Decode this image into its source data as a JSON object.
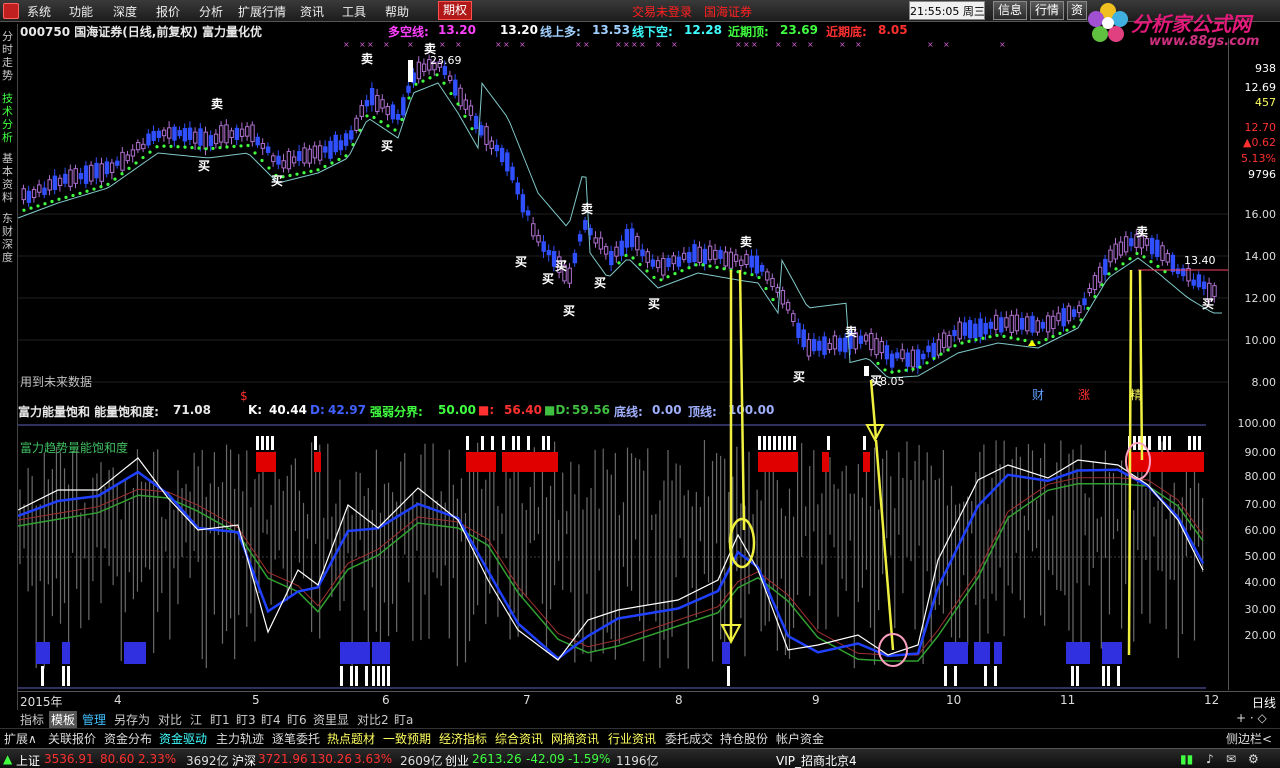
{
  "menu": {
    "items": [
      "系统",
      "功能",
      "深度",
      "报价",
      "分析",
      "扩展行情",
      "资讯",
      "工具",
      "帮助"
    ],
    "options_tab": "期权",
    "trade_status": "交易未登录",
    "broker": "国海证券",
    "time": "21:55:05",
    "weekday": "周三",
    "buttons": [
      "信息",
      "行情",
      "资"
    ]
  },
  "watermark": {
    "title": "分析家公式网",
    "url": "www.88gs.com"
  },
  "side_tabs": [
    "分时走势",
    "技术分析",
    "基本资料",
    "东财深度"
  ],
  "header": {
    "stock": "000750 国海证券(日线,前复权) 富力量化优",
    "duokong_label": "多空线:",
    "duokong_value": "13.20",
    "v2": "13.20",
    "xianshangduo_label": "线上多:",
    "xianshangduo_value": "13.53",
    "xianxiakong_label": "线下空:",
    "xianxiakong_value": "12.28",
    "jinqiding_label": "近期顶:",
    "jinqiding_value": "23.69",
    "jinqidi_label": "近期底:",
    "jinqidi_value": "8.05"
  },
  "chart_labels": {
    "future_data": "用到未来数据",
    "high_price": "23.69",
    "low_price": "8.05",
    "last_price": "13.40",
    "dollar_mark": "$",
    "cai": "财",
    "zhang": "涨",
    "zhang2": "精",
    "buy": "买",
    "sell": "卖"
  },
  "indicator_header": {
    "title": "富力能量饱和 能量饱和度:",
    "value": "71.08",
    "k_label": "K:",
    "k_value": "40.44",
    "d_label": "D:",
    "d_value": "42.97",
    "qiangruo_label": "强弱分界:",
    "qiangruo_value": "50.00",
    "m1_label": "■:",
    "m1_value": "56.40",
    "m2_label": "■D:",
    "m2_value": "59.56",
    "dixian_label": "底线:",
    "dixian_value": "0.00",
    "dingxian_label": "顶线:",
    "dingxian_value": "100.00"
  },
  "indicator_title2": "富力趋势量能饱和度",
  "right_axis": {
    "main": [
      "938",
      "12.69",
      "457",
      "12.70",
      "▲0.62",
      "5.13%",
      "9796",
      "16.00",
      "14.00",
      "12.00",
      "10.00",
      "8.00"
    ],
    "indicator": [
      "100.00",
      "90.00",
      "80.00",
      "70.00",
      "60.00",
      "50.00",
      "40.00",
      "30.00",
      "20.00"
    ],
    "date_right": "日线",
    "controls": "+ · ◇"
  },
  "date_axis": [
    "2015年",
    "4",
    "5",
    "6",
    "7",
    "8",
    "9",
    "10",
    "11",
    "12"
  ],
  "tabs1": [
    "指标",
    "模板",
    "管理",
    "另存为",
    "对比",
    "江",
    "盯1",
    "盯3",
    "盯4",
    "盯6",
    "资里显",
    "对比2",
    "盯a"
  ],
  "tabs2": [
    "扩展∧",
    "关联报价",
    "资金分布",
    "资金驱动",
    "主力轨迹",
    "逐笔委托",
    "热点题材",
    "一致预期",
    "经济指标",
    "综合资讯",
    "网摘资讯",
    "行业资讯",
    "委托成交",
    "持仓股份",
    "帐户资金"
  ],
  "tabs2_right": "侧边栏<",
  "status": {
    "sh_label": "上证",
    "sh_value": "3536.91",
    "sh_change": "80.60",
    "sh_pct": "2.33%",
    "sh_amount": "3692亿",
    "hs_label": "沪深",
    "hs_value": "3721.96",
    "hs_change": "130.26",
    "hs_pct": "3.63%",
    "hs_amount": "2609亿",
    "cy_label": "创业",
    "cy_value": "2613.26",
    "cy_change": "-42.09",
    "cy_pct": "-1.59%",
    "cy_amount": "1196亿",
    "server": "VIP_招商北京4"
  },
  "colors": {
    "up": "#ff3030",
    "down": "#00ffff",
    "candle_up": "#b070d0",
    "candle_down": "#3050ff",
    "dots": "#40ff40",
    "line_cyan": "#80c8c8",
    "k": "#ffffff",
    "d": "#2040ff",
    "j": "#30a030",
    "annot": "#f0f040"
  }
}
